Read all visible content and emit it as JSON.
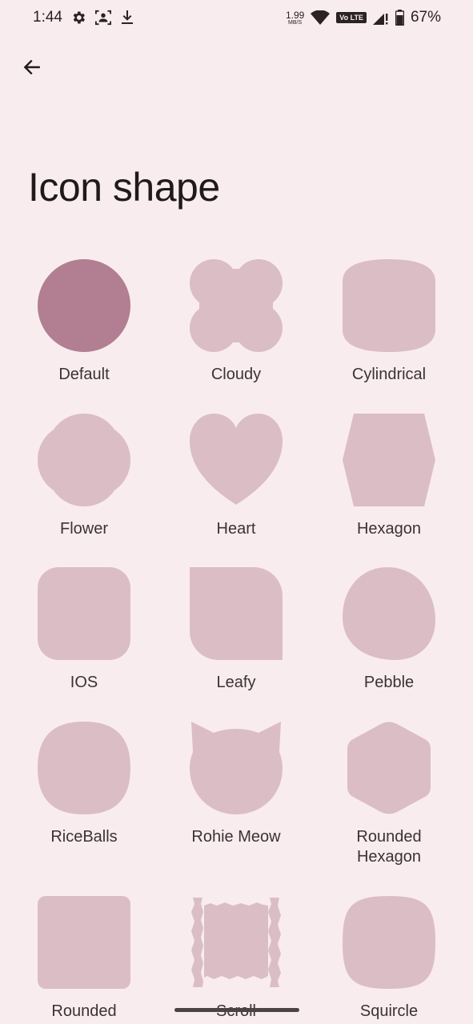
{
  "status_bar": {
    "time": "1:44",
    "net_speed_value": "1.99",
    "net_speed_unit": "MB/S",
    "volte": "Vo LTE",
    "battery": "67%",
    "icons": [
      "settings-icon",
      "screenshot-icon",
      "download-icon",
      "wifi-icon",
      "volte-icon",
      "signal-icon",
      "battery-icon"
    ]
  },
  "header": {
    "back_icon": "arrow-back-icon",
    "title": "Icon shape"
  },
  "colors": {
    "background": "#f9ecee",
    "shape_default": "#b17e92",
    "shape": "#dbbec5",
    "text": "#3b3234"
  },
  "shapes": [
    {
      "label": "Default",
      "selected": true
    },
    {
      "label": "Cloudy",
      "selected": false
    },
    {
      "label": "Cylindrical",
      "selected": false
    },
    {
      "label": "Flower",
      "selected": false
    },
    {
      "label": "Heart",
      "selected": false
    },
    {
      "label": "Hexagon",
      "selected": false
    },
    {
      "label": "IOS",
      "selected": false
    },
    {
      "label": "Leafy",
      "selected": false
    },
    {
      "label": "Pebble",
      "selected": false
    },
    {
      "label": "RiceBalls",
      "selected": false
    },
    {
      "label": "Rohie Meow",
      "selected": false
    },
    {
      "label": "Rounded Hexagon",
      "selected": false
    },
    {
      "label": "Rounded",
      "selected": false
    },
    {
      "label": "Scroll",
      "selected": false
    },
    {
      "label": "Squircle",
      "selected": false
    }
  ]
}
